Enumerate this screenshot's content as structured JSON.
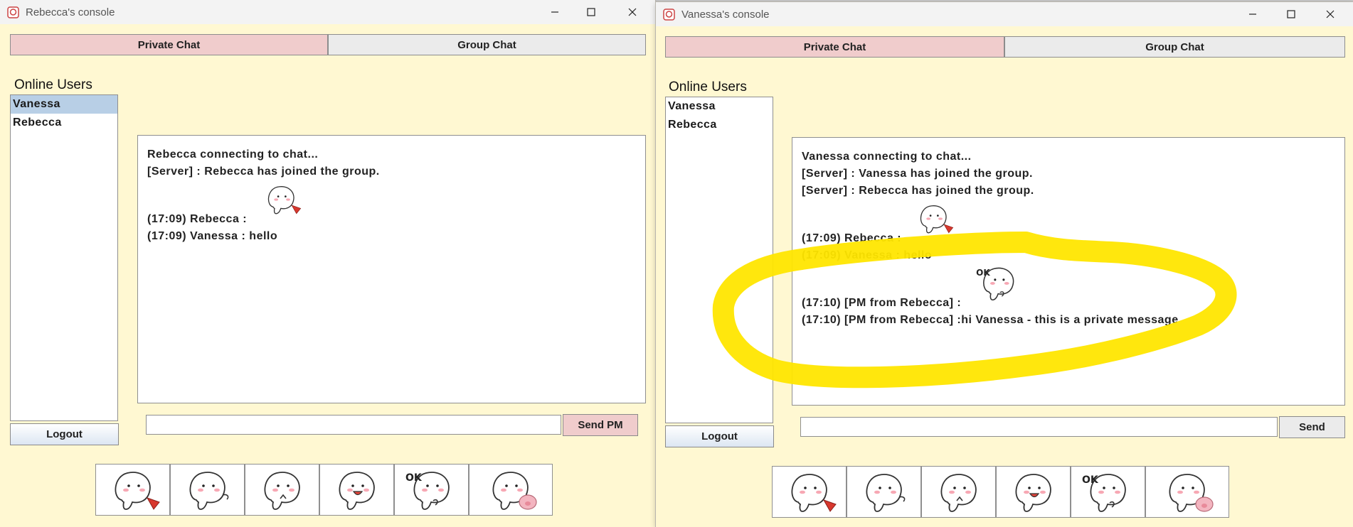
{
  "window_a": {
    "title": "Rebecca's console",
    "tabs": [
      {
        "label": "Private Chat",
        "active": true
      },
      {
        "label": "Group Chat",
        "active": false
      }
    ],
    "online_users_label": "Online Users",
    "users": [
      {
        "name": "Vanessa",
        "selected": true
      },
      {
        "name": "Rebecca",
        "selected": false
      }
    ],
    "logout_label": "Logout",
    "chat_lines": [
      "Rebecca connecting to chat...",
      "[Server] : Rebecca has joined the group.",
      "(17:09) Rebecca :",
      "(17:09) Vanessa : hello"
    ],
    "chat_stickers": [
      "pointing-with-heart-sticker"
    ],
    "message_input_value": "",
    "send_label": "Send PM"
  },
  "window_b": {
    "title": "Vanessa's console",
    "tabs": [
      {
        "label": "Private Chat",
        "active": true
      },
      {
        "label": "Group Chat",
        "active": false
      }
    ],
    "online_users_label": "Online Users",
    "users": [
      {
        "name": "Vanessa",
        "selected": false
      },
      {
        "name": "Rebecca",
        "selected": false
      }
    ],
    "logout_label": "Logout",
    "chat_lines": [
      "Vanessa connecting to chat...",
      "[Server] : Vanessa has joined the group.",
      "[Server] : Rebecca has joined the group.",
      "(17:09) Rebecca :",
      "(17:09) Vanessa : hello",
      "(17:10) [PM from Rebecca] :",
      "(17:10) [PM from Rebecca] :hi Vanessa - this is a private message"
    ],
    "chat_stickers": [
      "pointing-with-heart-sticker",
      "ok-sticker"
    ],
    "message_input_value": "",
    "send_label": "Send"
  },
  "sticker_bar": [
    {
      "name": "pointing-with-heart-sticker"
    },
    {
      "name": "blushing-wave-sticker"
    },
    {
      "name": "shy-fingers-sticker"
    },
    {
      "name": "laughing-sticker"
    },
    {
      "name": "ok-sticker",
      "caption": "OK"
    },
    {
      "name": "pig-friend-sticker"
    }
  ],
  "colors": {
    "window_bg": "#fff8d2",
    "active_tab": "#f0cccc",
    "inactive_tab": "#ebebeb",
    "selected_user": "#b8cfe6",
    "highlight_annotation": "#ffe600"
  }
}
